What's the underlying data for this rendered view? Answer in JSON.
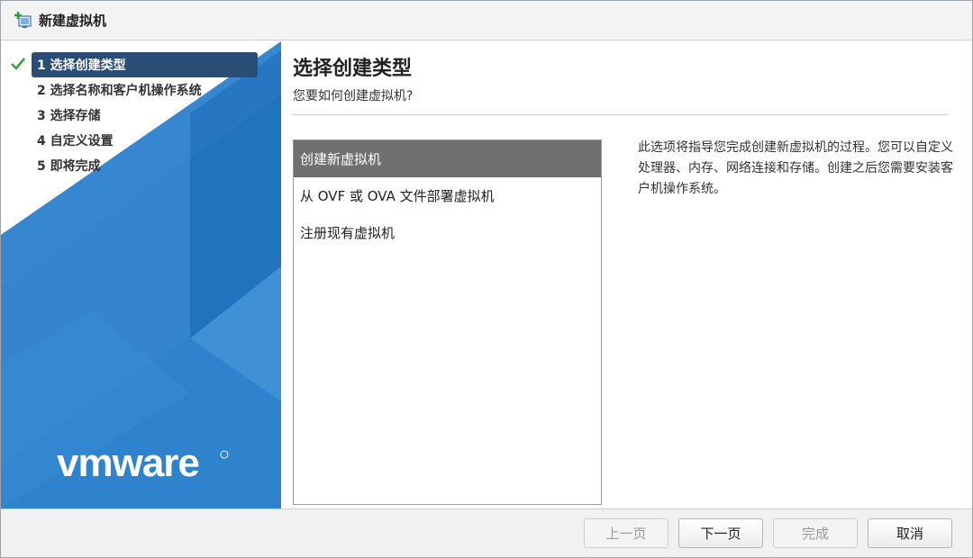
{
  "window": {
    "title": "新建虚拟机"
  },
  "sidebar": {
    "steps": [
      {
        "label": "1 选择创建类型",
        "state": "active",
        "completed": true
      },
      {
        "label": "2 选择名称和客户机操作系统",
        "state": "pending"
      },
      {
        "label": "3 选择存储",
        "state": "pending"
      },
      {
        "label": "4 自定义设置",
        "state": "pending"
      },
      {
        "label": "5 即将完成",
        "state": "pending"
      }
    ],
    "logo_text": "vmware",
    "active_color": "#2a4d75",
    "art_color": "#2b7cc7"
  },
  "main": {
    "title": "选择创建类型",
    "subtitle": "您要如何创建虚拟机?",
    "options": [
      {
        "label": "创建新虚拟机",
        "selected": true
      },
      {
        "label": "从 OVF 或 OVA 文件部署虚拟机",
        "selected": false
      },
      {
        "label": "注册现有虚拟机",
        "selected": false
      }
    ],
    "description": "此选项将指导您完成创建新虚拟机的过程。您可以自定义处理器、内存、网络连接和存储。创建之后您需要安装客户机操作系统。"
  },
  "footer": {
    "prev_label": "上一页",
    "next_label": "下一页",
    "finish_label": "完成",
    "cancel_label": "取消",
    "prev_enabled": false,
    "next_enabled": true,
    "finish_enabled": false,
    "cancel_enabled": true
  }
}
